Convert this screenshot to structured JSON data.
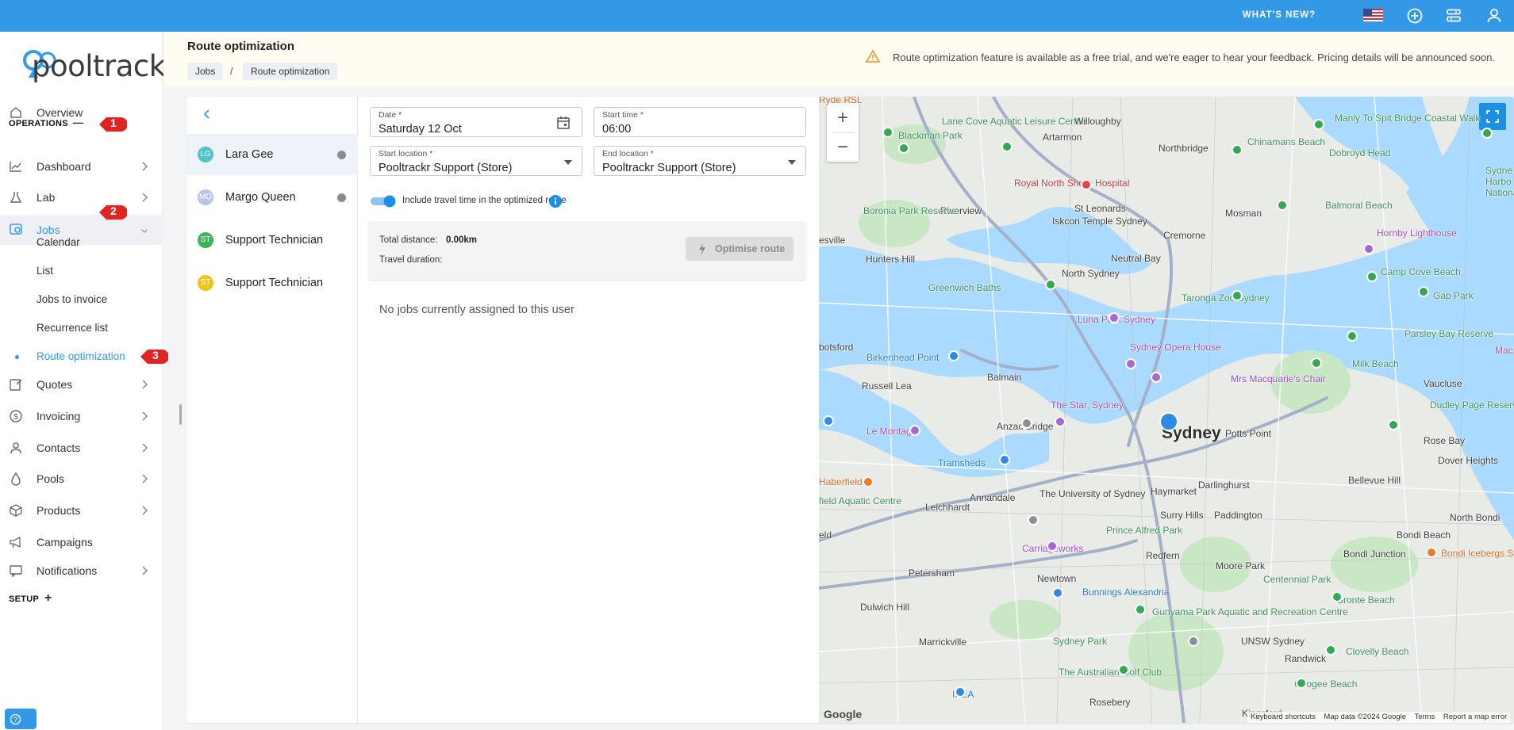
{
  "topbar": {
    "whats_new": "WHAT'S NEW?",
    "icons": [
      "us-flag-icon",
      "add-circle-icon",
      "settings-icon",
      "user-icon"
    ],
    "color": "#3399e6"
  },
  "sidebar": {
    "logo_text": "pooltrackr",
    "overview": "Overview",
    "operations_label": "OPERATIONS",
    "operations_toggle": "—",
    "items": [
      {
        "label": "Dashboard",
        "icon": "chart-icon"
      },
      {
        "label": "Lab",
        "icon": "flask-icon"
      },
      {
        "label": "Jobs",
        "icon": "jobs-icon"
      },
      {
        "label": "Quotes",
        "icon": "quote-icon"
      },
      {
        "label": "Invoicing",
        "icon": "dollar-icon"
      },
      {
        "label": "Contacts",
        "icon": "person-icon"
      },
      {
        "label": "Pools",
        "icon": "droplet-icon"
      },
      {
        "label": "Products",
        "icon": "box-icon"
      },
      {
        "label": "Campaigns",
        "icon": "megaphone-icon"
      },
      {
        "label": "Notifications",
        "icon": "message-icon"
      }
    ],
    "jobs_sub": [
      "Calendar",
      "List",
      "Jobs to invoice",
      "Recurrence list",
      "Route optimization"
    ],
    "setup_label": "SETUP",
    "setup_toggle": "+",
    "badges": [
      "1",
      "2",
      "3"
    ]
  },
  "header": {
    "title": "Route optimization",
    "breadcrumb": [
      "Jobs",
      "Route optimization"
    ],
    "breadcrumb_sep": "/",
    "notice": "Route optimization feature is available as a free trial, and we're eager to hear your feedback. Pricing details will be announced soon."
  },
  "users": [
    {
      "initials": "LG",
      "name": "Lara Gee",
      "color": "#4fc3c7",
      "selected": true,
      "dot": true
    },
    {
      "initials": "MQ",
      "name": "Margo Queen",
      "color": "#b6c3ea",
      "selected": false,
      "dot": true
    },
    {
      "initials": "ST",
      "name": "Support Technician",
      "color": "#3cb356",
      "selected": false,
      "dot": false
    },
    {
      "initials": "ST",
      "name": "Support Technician",
      "color": "#f0c419",
      "selected": false,
      "dot": false
    }
  ],
  "form": {
    "date_label": "Date *",
    "date_value": "Saturday 12 Oct",
    "start_time_label": "Start time *",
    "start_time_value": "06:00",
    "start_location_label": "Start location *",
    "start_location_value": "Pooltrackr Support (Store)",
    "end_location_label": "End location *",
    "end_location_value": "Pooltrackr Support (Store)",
    "toggle_label": "Include travel time in the optimized route",
    "toggle_on": true,
    "total_distance_label": "Total distance:",
    "total_distance_value": "0.00km",
    "travel_duration_label": "Travel duration:",
    "optimise_button": "Optimise route",
    "empty_message": "No jobs currently assigned to this user"
  },
  "map": {
    "zoom_in": "+",
    "zoom_out": "−",
    "labels": {
      "ryde_rsl": "Ryde RSL",
      "lane_cove": "Lane Cove Aquatic Leisure Centre",
      "willoughby": "Willoughby",
      "northbridge": "Northbridge",
      "artarmon": "Artarmon",
      "blackman_park": "Blackman Park",
      "chinamans_beach": "Chinamans Beach",
      "dobroyd_head": "Dobroyd Head",
      "manly_bridge": "Manly To Spit Bridge Coastal Walk",
      "royal_north": "Royal North Shore Hospital",
      "st_leonards": "St Leonards",
      "riverview": "Riverview",
      "boronia": "Boronia Park Reserve",
      "iskcon": "Iskcon Temple Sydney",
      "mosman": "Mosman",
      "balmoral": "Balmoral Beach",
      "cremorne": "Cremorne",
      "hornby": "Hornby Lighthouse",
      "hunters_hill": "Hunters Hill",
      "neutral_bay": "Neutral Bay",
      "north_sydney": "North Sydney",
      "greenwich": "Greenwich Baths",
      "taronga": "Taronga Zoo Sydney",
      "camp_cove": "Camp Cove Beach",
      "gap_park": "Gap Park",
      "luna_park": "Luna Park Sydney",
      "sydney_opera": "Sydney Opera House",
      "birkenhead": "Birkenhead Point",
      "mrs_macquarie": "Mrs Macquarie's Chair",
      "parsley_bay": "Parsley Bay Reserve",
      "milk_beach": "Milk Beach",
      "vaucluse": "Vaucluse",
      "russell_lea": "Russell Lea",
      "balmain": "Balmain",
      "the_star": "The Star, Sydney",
      "dudley_page": "Dudley Page Reserve",
      "le_montage": "Le Montage",
      "anzac_bridge": "Anzac Bridge",
      "sydney": "Sydney",
      "potts_point": "Potts Point",
      "rose_bay": "Rose Bay",
      "dover_heights": "Dover Heights",
      "tramsheds": "Tramsheds",
      "darlinghurst": "Darlinghurst",
      "haberfield": "Haberfield",
      "bellevue_hill": "Bellevue Hill",
      "annandale": "Annandale",
      "uni_sydney": "The University of Sydney",
      "haymarket": "Haymarket",
      "leichhardt": "Leichhardt",
      "surry_hills": "Surry Hills",
      "paddington": "Paddington",
      "north_bondi": "North Bondi",
      "prince_alfred": "Prince Alfred Park",
      "bondi_beach": "Bondi Beach",
      "carriageworks": "Carriageworks",
      "redfern": "Redfern",
      "bondi_junction": "Bondi Junction",
      "bondi_icebergs": "Bondi Icebergs Swimming Club",
      "petersham": "Petersham",
      "newtown": "Newtown",
      "moore_park": "Moore Park",
      "centennial": "Centennial Park",
      "bunnings": "Bunnings Alexandria",
      "bronte_beach": "Bronte Beach",
      "dulwich_hill": "Dulwich Hill",
      "gunyama": "Gunyama Park Aquatic and Recreation Centre",
      "marrickville": "Marrickville",
      "sydney_park": "Sydney Park",
      "unsw": "UNSW Sydney",
      "randwick": "Randwick",
      "clovelly": "Clovelly Beach",
      "aust_golf": "The Australian Golf Club",
      "coogee": "Coogee Beach",
      "ikea": "IKEA",
      "rosebery": "Rosebery",
      "kingsford": "Kingsford",
      "esville": "esville",
      "botsford": "botsford",
      "field_aquatic": "field Aquatic Centre",
      "eld": "eld",
      "sydney_harbour_nat": "Sydne Harbo Nationa",
      "mac": "Mac"
    },
    "google": "Google",
    "footer_shortcuts": "Keyboard shortcuts",
    "footer_data": "Map data ©2024 Google",
    "footer_terms": "Terms",
    "footer_report": "Report a map error"
  }
}
